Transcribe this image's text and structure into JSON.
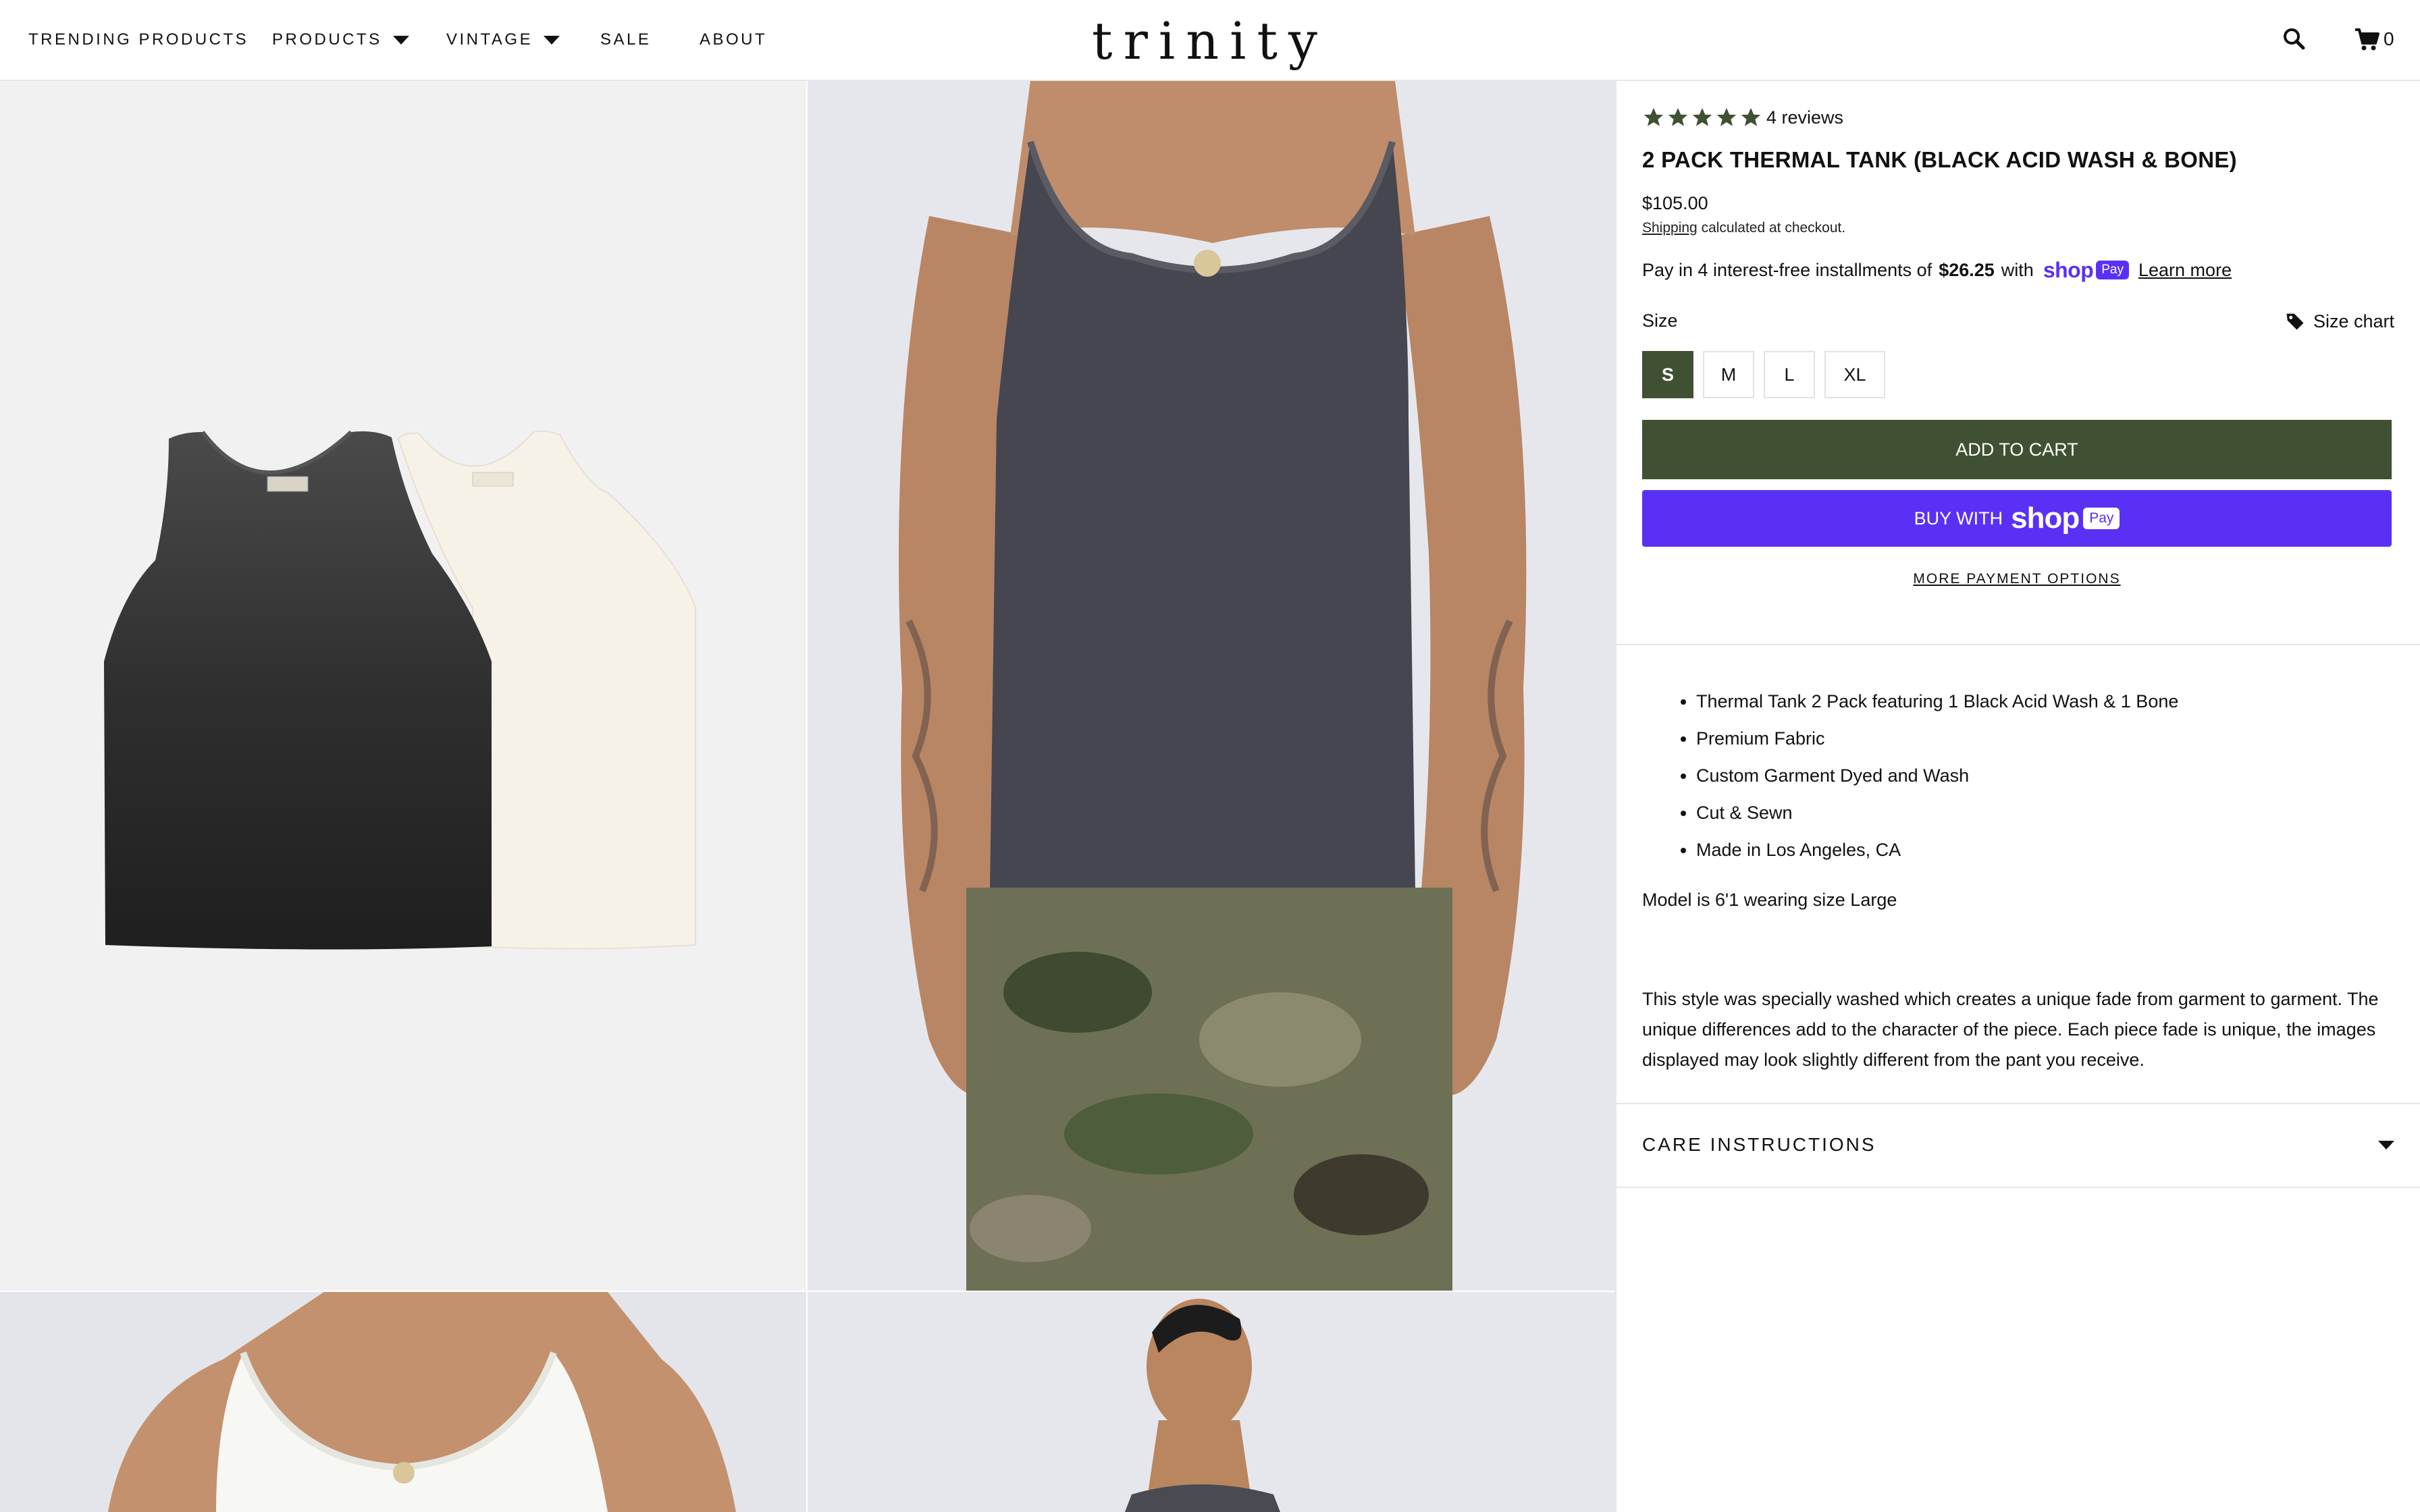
{
  "header": {
    "nav": [
      {
        "label": "TRENDING PRODUCTS",
        "has_dropdown": false
      },
      {
        "label": "PRODUCTS",
        "has_dropdown": true
      },
      {
        "label": "VINTAGE",
        "has_dropdown": true
      },
      {
        "label": "SALE",
        "has_dropdown": false
      },
      {
        "label": "ABOUT",
        "has_dropdown": false
      }
    ],
    "logo": "trinity",
    "search_icon": "search-icon",
    "cart_icon": "cart-icon",
    "cart_count": "0"
  },
  "gallery": {
    "images": [
      {
        "name": "product-flat-lay-image",
        "description_icon": "tank-pair"
      },
      {
        "name": "model-front-black-tank-image",
        "description_icon": "model-torso"
      },
      {
        "name": "model-bone-tank-image",
        "description_icon": "model-torso"
      },
      {
        "name": "model-side-profile-image",
        "description_icon": "model-head"
      }
    ]
  },
  "product": {
    "rating_stars": 5,
    "reviews_label": "4 reviews",
    "title": "2 PACK THERMAL TANK (BLACK ACID WASH & BONE)",
    "price": "$105.00",
    "shipping_link": "Shipping",
    "shipping_note": "calculated at checkout.",
    "installments": {
      "prefix": "Pay in 4 interest-free installments of",
      "amount": "$26.25",
      "suffix": "with",
      "shop_word": "shop",
      "pay_pill": "Pay",
      "learn_more": "Learn more"
    },
    "size_label": "Size",
    "size_chart": "Size chart",
    "sizes": [
      "S",
      "M",
      "L",
      "XL"
    ],
    "selected_size": "S",
    "add_to_cart": "ADD TO CART",
    "buy_with": "BUY WITH",
    "buy_shop_word": "shop",
    "buy_pay_pill": "Pay",
    "more_payment_options": "MORE PAYMENT OPTIONS",
    "bullets": [
      "Thermal Tank 2 Pack featuring 1 Black Acid Wash & 1 Bone",
      "Premium Fabric",
      "Custom Garment Dyed and Wash",
      "Cut & Sewn",
      "Made in Los Angeles, CA"
    ],
    "model_note": "Model is 6'1 wearing size Large",
    "description": "This style was specially washed which creates a unique fade from garment to garment. The unique differences add to the character of the piece. Each piece fade is unique, the images displayed may look slightly different from the pant you receive.",
    "care_instructions": "CARE INSTRUCTIONS"
  },
  "colors": {
    "accent_green": "#3f5132",
    "shop_purple": "#5a31f4",
    "star_green": "#3f5132"
  }
}
